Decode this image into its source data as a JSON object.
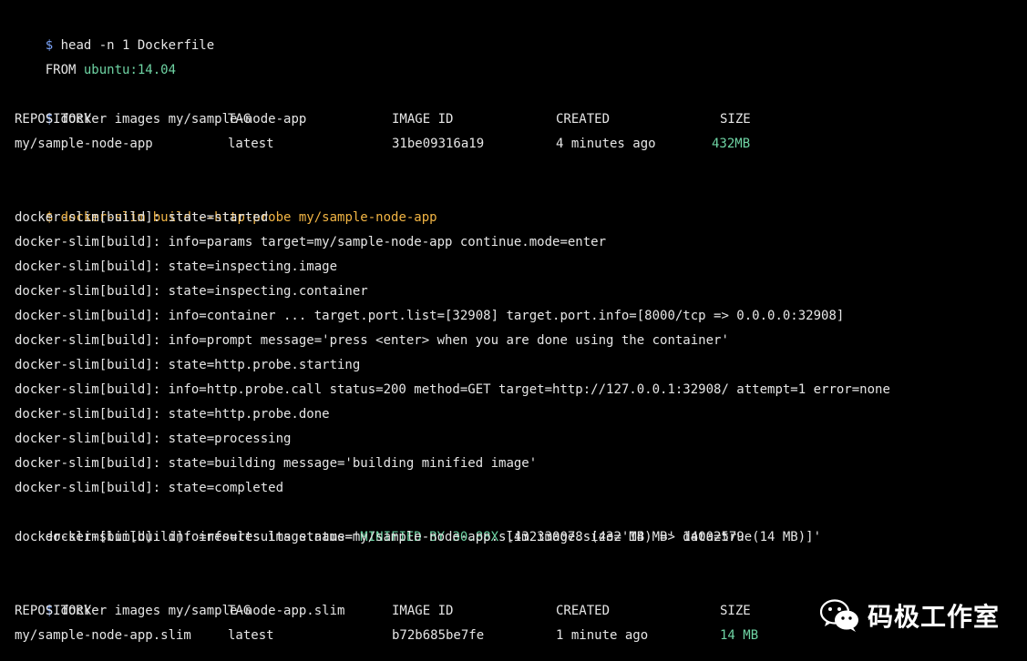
{
  "colors": {
    "background": "#000000",
    "text": "#e6e6e6",
    "prompt": "#7aa2f7",
    "highlight_green": "#6ed3a3",
    "highlight_yellow": "#f2b544"
  },
  "block1": {
    "prompt": "$",
    "command": " head -n 1 Dockerfile",
    "from_keyword": "FROM ",
    "from_image": "ubuntu:14.04"
  },
  "block2": {
    "prompt": "$",
    "command": " docker images my/sample-node-app",
    "headers": [
      "REPOSITORY",
      "TAG",
      "IMAGE ID",
      "CREATED",
      "SIZE"
    ],
    "row": [
      "my/sample-node-app",
      "latest",
      "31be09316a19",
      "4 minutes ago",
      "432MB"
    ]
  },
  "block3": {
    "prompt": "$",
    "command": " docker-slim build --http-probe my/sample-node-app",
    "lines": [
      "docker-slim[build]: state=started",
      "docker-slim[build]: info=params target=my/sample-node-app continue.mode=enter",
      "docker-slim[build]: state=inspecting.image",
      "docker-slim[build]: state=inspecting.container",
      "docker-slim[build]: info=container ... target.port.list=[32908] target.port.info=[8000/tcp => 0.0.0.0:32908]",
      "docker-slim[build]: info=prompt message='press <enter> when you are done using the container'",
      "docker-slim[build]: state=http.probe.starting",
      "docker-slim[build]: info=http.probe.call status=200 method=GET target=http://127.0.0.1:32908/ attempt=1 error=none",
      "docker-slim[build]: state=http.probe.done",
      "docker-slim[build]: state=processing",
      "docker-slim[build]: state=building message='building minified image'",
      "docker-slim[build]: state=completed"
    ],
    "results_prefix": "docker-slim[build]: info=results status='",
    "results_highlight": "MINIFIED BY 30.88X",
    "results_suffix": " [432330078 (432 MB) => 14002579 (14 MB)]'",
    "final_line": "docker-slim[build]: info=results image.name=my/sample-node-app.slim image.size='14 MB' data=true"
  },
  "block4": {
    "prompt": "$",
    "command": " docker images my/sample-node-app.slim",
    "headers": [
      "REPOSITORY",
      "TAG",
      "IMAGE ID",
      "CREATED",
      "SIZE"
    ],
    "row": [
      "my/sample-node-app.slim",
      "latest",
      "b72b685be7fe",
      "1 minute ago",
      "14 MB"
    ]
  },
  "watermark": {
    "icon": "wechat-icon",
    "text": "码极工作室"
  }
}
